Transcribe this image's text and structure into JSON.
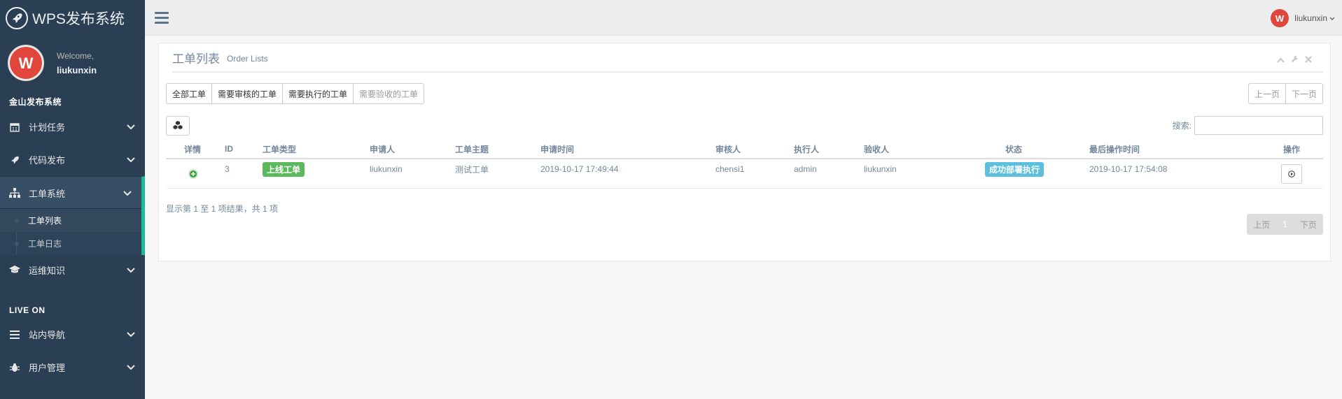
{
  "brand": {
    "title": "WPS发布系统",
    "icon": "rocket-icon"
  },
  "profile": {
    "welcome": "Welcome,",
    "name": "liukunxin"
  },
  "sidebar": {
    "section1": "金山发布系统",
    "items": [
      {
        "label": "计划任务",
        "icon": "calendar-icon"
      },
      {
        "label": "代码发布",
        "icon": "rocket-icon"
      },
      {
        "label": "工单系统",
        "icon": "sitemap-icon"
      },
      {
        "label": "运维知识",
        "icon": "graduation-cap-icon"
      }
    ],
    "children": [
      {
        "label": "工单列表"
      },
      {
        "label": "工单日志"
      }
    ],
    "section2": "LIVE ON",
    "items2": [
      {
        "label": "站内导航",
        "icon": "bars-icon"
      },
      {
        "label": "用户管理",
        "icon": "bug-icon"
      }
    ]
  },
  "topnav": {
    "username": "liukunxin"
  },
  "panel": {
    "title": "工单列表",
    "subtitle": "Order Lists",
    "filters": [
      "全部工单",
      "需要审核的工单",
      "需要执行的工单",
      "需要验收的工单"
    ],
    "prev_page": "上一页",
    "next_page": "下一页",
    "search_label": "搜索:",
    "search_value": "",
    "columns": [
      "详情",
      "ID",
      "工单类型",
      "申请人",
      "工单主题",
      "申请时间",
      "审核人",
      "执行人",
      "验收人",
      "状态",
      "最后操作时间",
      "操作"
    ],
    "rows": [
      {
        "id": "3",
        "type": "上线工单",
        "applicant": "liukunxin",
        "subject": "测试工单",
        "apply_time": "2019-10-17 17:49:44",
        "reviewer": "chensi1",
        "executor": "admin",
        "acceptor": "liukunxin",
        "status": "成功部署执行",
        "last_time": "2019-10-17 17:54:08"
      }
    ],
    "info": "显示第 1 至 1 项结果，共 1 项",
    "pager": {
      "prev": "上页",
      "page": "1",
      "next": "下页"
    }
  },
  "colors": {
    "sidebar": "#2A3F54",
    "accent": "#1ABB9C",
    "label_green": "#5CB85C",
    "label_cyan": "#5BC0DE",
    "wps_red": "#E0463C"
  }
}
